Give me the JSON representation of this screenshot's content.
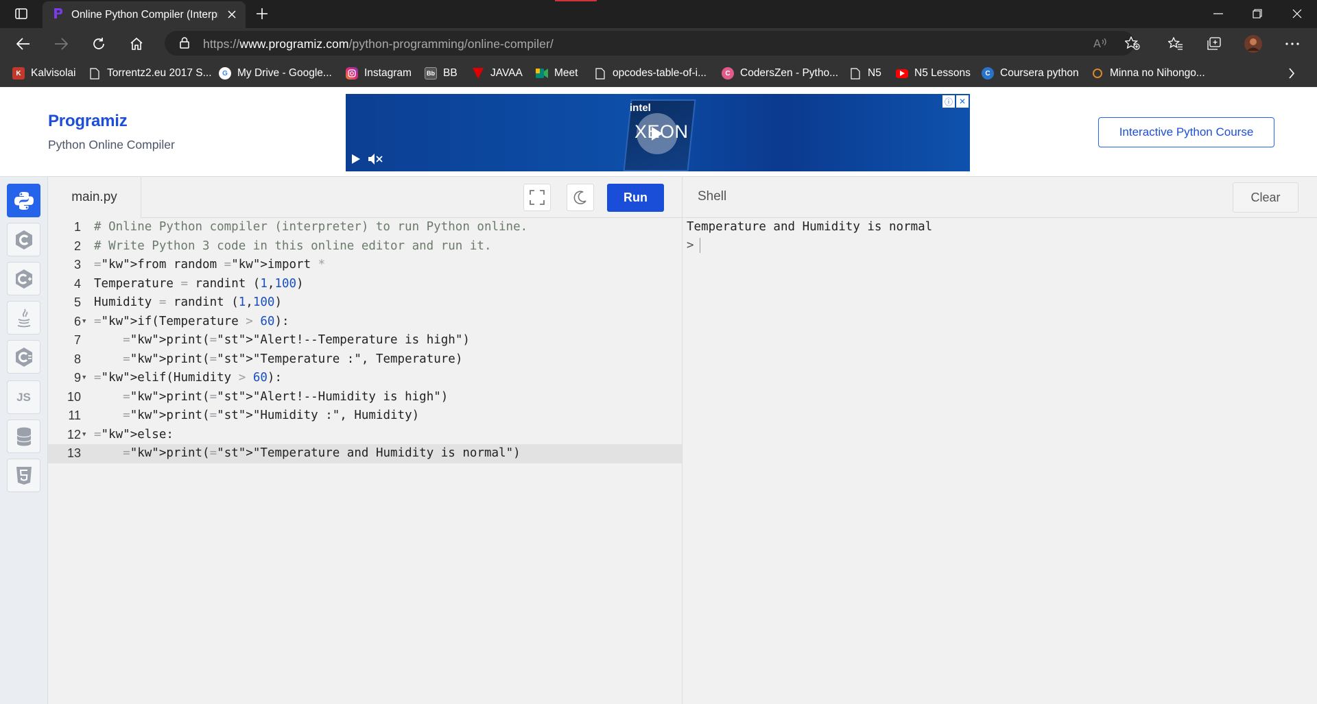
{
  "browser": {
    "tab_title": "Online Python Compiler (Interpre",
    "url_prefix": "https://",
    "url_host": "www.programiz.com",
    "url_path": "/python-programming/online-compiler/",
    "bookmarks": [
      {
        "label": "Kalvisolai",
        "icon": "kalvisolai-icon",
        "color": "#c0392b"
      },
      {
        "label": "Torrentz2.eu 2017 S...",
        "icon": "page-icon",
        "color": "#333333"
      },
      {
        "label": "My Drive - Google...",
        "icon": "google-icon",
        "color": "#ffffff"
      },
      {
        "label": "Instagram",
        "icon": "instagram-icon",
        "color": "#d6249f"
      },
      {
        "label": "BB",
        "icon": "bb-icon",
        "color": "#444444"
      },
      {
        "label": "JAVAA",
        "icon": "javaa-icon",
        "color": "#e00000"
      },
      {
        "label": "Meet",
        "icon": "meet-icon",
        "color": "#00897b"
      },
      {
        "label": "opcodes-table-of-i...",
        "icon": "page-icon",
        "color": "#333333"
      },
      {
        "label": "CodersZen - Pytho...",
        "icon": "coderszen-icon",
        "color": "#e25a8c"
      },
      {
        "label": "N5",
        "icon": "page-icon",
        "color": "#333333"
      },
      {
        "label": "N5 Lessons",
        "icon": "youtube-icon",
        "color": "#ff0000"
      },
      {
        "label": "Coursera python",
        "icon": "coursera-icon",
        "color": "#2a73cc"
      },
      {
        "label": "Minna no Nihongo...",
        "icon": "minna-icon",
        "color": "#d68a2e"
      }
    ]
  },
  "header": {
    "logo": "Programiz",
    "subtitle": "Python Online Compiler",
    "course_button": "Interactive Python Course",
    "ad": {
      "brand": "intel",
      "product": "XEON"
    }
  },
  "languages": [
    {
      "name": "python",
      "active": true
    },
    {
      "name": "c",
      "active": false
    },
    {
      "name": "cpp",
      "active": false
    },
    {
      "name": "java",
      "active": false
    },
    {
      "name": "csharp",
      "active": false
    },
    {
      "name": "js",
      "label": "JS",
      "active": false
    },
    {
      "name": "sql",
      "active": false
    },
    {
      "name": "html",
      "active": false
    }
  ],
  "editor": {
    "file_name": "main.py",
    "run_label": "Run",
    "lines": [
      "# Online Python compiler (interpreter) to run Python online.",
      "# Write Python 3 code in this online editor and run it.",
      "from random import *",
      "Temperature = randint (1,100)",
      "Humidity = randint (1,100)",
      "if(Temperature > 60):",
      "    print(\"Alert!--Temperature is high\")",
      "    print(\"Temperature :\", Temperature)",
      "elif(Humidity > 60):",
      "    print(\"Alert!--Humidity is high\")",
      "    print(\"Humidity :\", Humidity)",
      "else:",
      "    print(\"Temperature and Humidity is normal\")"
    ],
    "line_numbers": [
      "1",
      "2",
      "3",
      "4",
      "5",
      "6",
      "7",
      "8",
      "9",
      "10",
      "11",
      "12",
      "13"
    ],
    "current_line": 13
  },
  "shell": {
    "title": "Shell",
    "clear_label": "Clear",
    "output": "Temperature and Humidity is normal",
    "prompt": ">"
  }
}
